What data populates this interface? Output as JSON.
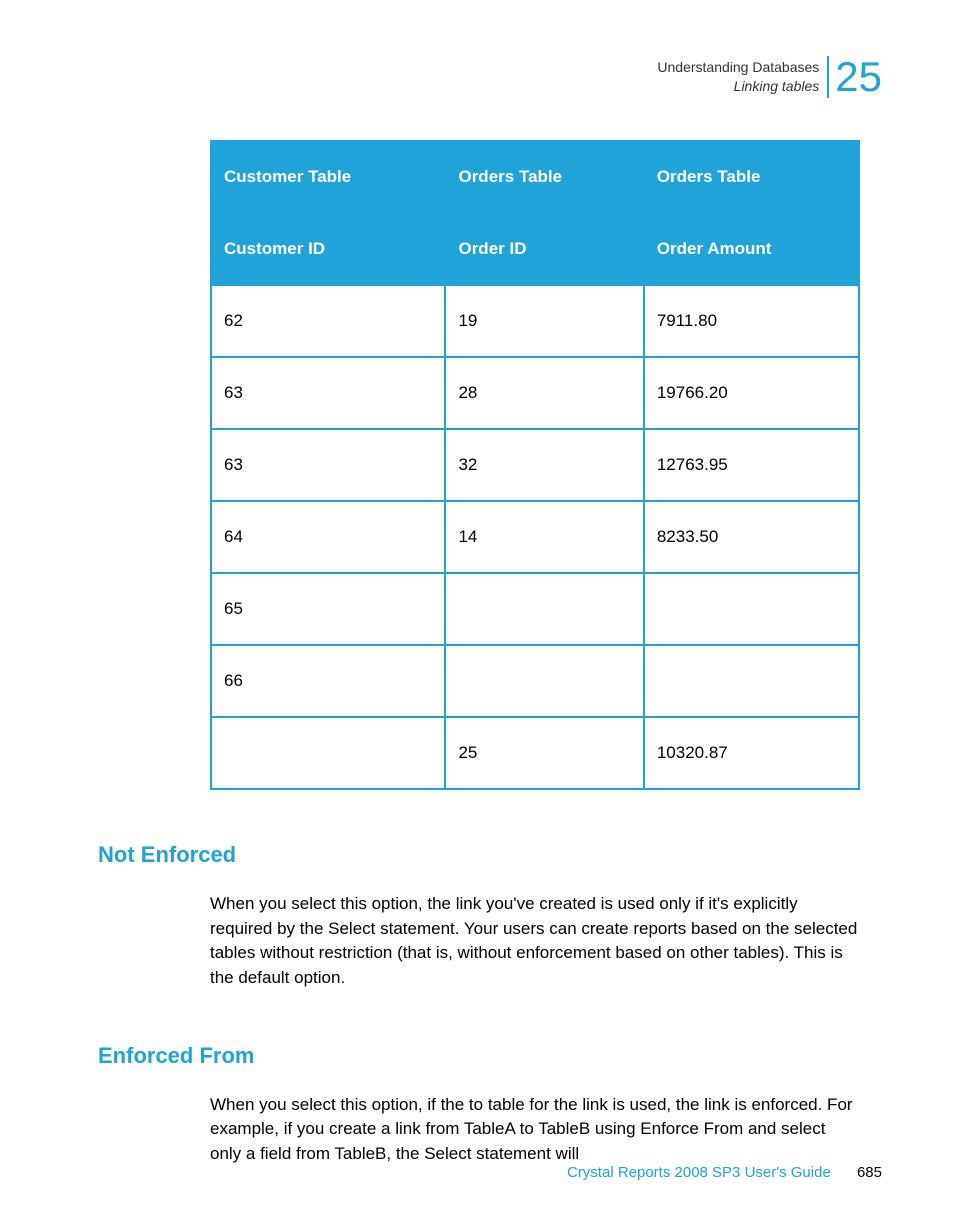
{
  "header": {
    "title_line1": "Understanding Databases",
    "title_line2": "Linking tables",
    "chapter_number": "25"
  },
  "table": {
    "headers_row1": [
      "Customer Table",
      "Orders Table",
      "Orders Table"
    ],
    "headers_row2": [
      "Customer ID",
      "Order ID",
      "Order Amount"
    ],
    "rows": [
      [
        "62",
        "19",
        "7911.80"
      ],
      [
        "63",
        "28",
        "19766.20"
      ],
      [
        "63",
        "32",
        "12763.95"
      ],
      [
        "64",
        "14",
        "8233.50"
      ],
      [
        "65",
        "",
        ""
      ],
      [
        "66",
        "",
        ""
      ],
      [
        "",
        "25",
        "10320.87"
      ]
    ]
  },
  "sections": {
    "not_enforced": {
      "heading": "Not Enforced",
      "body": "When you select this option, the link you've created is used only if it's explicitly required by the Select statement. Your users can create reports based on the selected tables without restriction (that is, without enforcement based on other tables). This is the default option."
    },
    "enforced_from": {
      "heading": "Enforced From",
      "body": "When you select this option, if the to table for the link is used, the link is enforced. For example, if you create a link from TableA to TableB using Enforce From and select only a field from TableB, the Select statement will"
    }
  },
  "footer": {
    "doc_title": "Crystal Reports 2008 SP3 User's Guide",
    "page_number": "685"
  },
  "chart_data": {
    "type": "table",
    "title": "",
    "columns": [
      "Customer ID",
      "Order ID",
      "Order Amount"
    ],
    "column_sources": [
      "Customer Table",
      "Orders Table",
      "Orders Table"
    ],
    "rows": [
      {
        "Customer ID": 62,
        "Order ID": 19,
        "Order Amount": 7911.8
      },
      {
        "Customer ID": 63,
        "Order ID": 28,
        "Order Amount": 19766.2
      },
      {
        "Customer ID": 63,
        "Order ID": 32,
        "Order Amount": 12763.95
      },
      {
        "Customer ID": 64,
        "Order ID": 14,
        "Order Amount": 8233.5
      },
      {
        "Customer ID": 65,
        "Order ID": null,
        "Order Amount": null
      },
      {
        "Customer ID": 66,
        "Order ID": null,
        "Order Amount": null
      },
      {
        "Customer ID": null,
        "Order ID": 25,
        "Order Amount": 10320.87
      }
    ]
  }
}
